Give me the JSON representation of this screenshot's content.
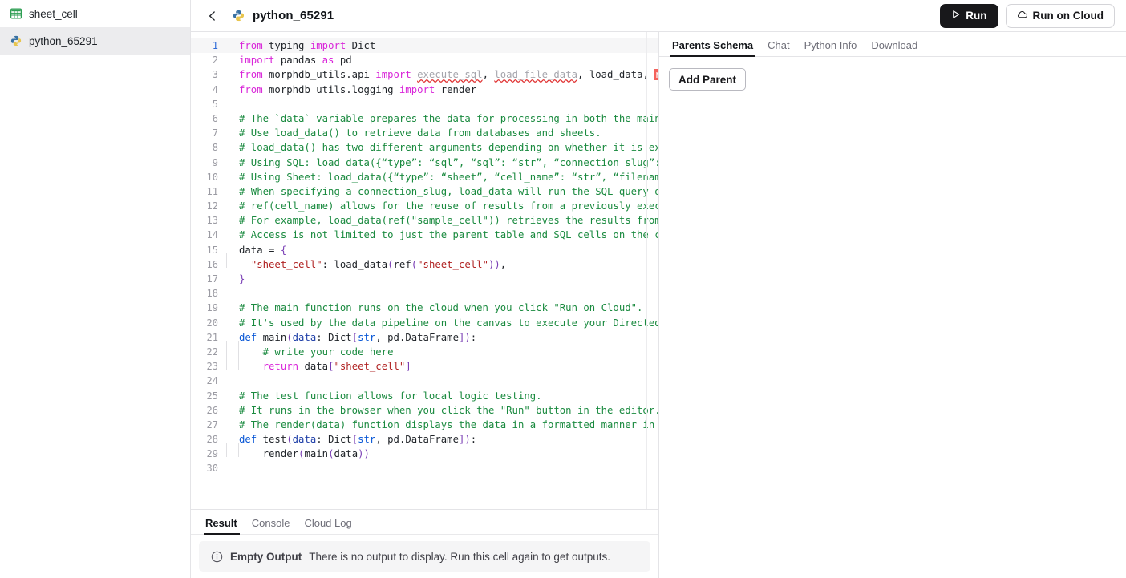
{
  "sidebar": {
    "items": [
      {
        "label": "sheet_cell",
        "icon": "sheet-grid-icon",
        "selected": false
      },
      {
        "label": "python_65291",
        "icon": "python-logo-icon",
        "selected": true
      }
    ]
  },
  "topbar": {
    "back_icon": "back-arrow-icon",
    "doc_icon": "python-logo-icon",
    "title": "python_65291",
    "run_label": "Run",
    "run_icon": "play-icon",
    "run_cloud_label": "Run on Cloud",
    "run_cloud_icon": "cloud-icon"
  },
  "editor": {
    "language": "python",
    "active_line": 1,
    "total_lines": 30,
    "lines": [
      {
        "n": 1,
        "tokens": [
          {
            "t": "from",
            "c": "kw"
          },
          {
            "t": " typing ",
            "c": "pl"
          },
          {
            "t": "import",
            "c": "kw"
          },
          {
            "t": " Dict",
            "c": "pl"
          }
        ]
      },
      {
        "n": 2,
        "tokens": [
          {
            "t": "import",
            "c": "kw"
          },
          {
            "t": " pandas ",
            "c": "pl"
          },
          {
            "t": "as",
            "c": "kw"
          },
          {
            "t": " pd",
            "c": "pl"
          }
        ]
      },
      {
        "n": 3,
        "tokens": [
          {
            "t": "from",
            "c": "kw"
          },
          {
            "t": " morphdb_utils.api ",
            "c": "pl"
          },
          {
            "t": "import",
            "c": "kw"
          },
          {
            "t": " ",
            "c": "pl"
          },
          {
            "t": "execute_sql",
            "c": "err"
          },
          {
            "t": ", ",
            "c": "pl"
          },
          {
            "t": "load_file_data",
            "c": "err"
          },
          {
            "t": ", load_data, ",
            "c": "pl"
          },
          {
            "t": "re",
            "c": "errhl"
          }
        ]
      },
      {
        "n": 4,
        "tokens": [
          {
            "t": "from",
            "c": "kw"
          },
          {
            "t": " morphdb_utils.logging ",
            "c": "pl"
          },
          {
            "t": "import",
            "c": "kw"
          },
          {
            "t": " render",
            "c": "pl"
          }
        ]
      },
      {
        "n": 5,
        "tokens": []
      },
      {
        "n": 6,
        "tokens": [
          {
            "t": "# The `data` variable prepares the data for processing in both the main a",
            "c": "cmt"
          }
        ]
      },
      {
        "n": 7,
        "tokens": [
          {
            "t": "# Use load_data() to retrieve data from databases and sheets.",
            "c": "cmt"
          }
        ]
      },
      {
        "n": 8,
        "tokens": [
          {
            "t": "# load_data() has two different arguments depending on whether it is exec",
            "c": "cmt"
          }
        ]
      },
      {
        "n": 9,
        "tokens": [
          {
            "t": "# Using SQL: load_data({“type”: “sql”, “sql”: “str”, “connection_slug”: “",
            "c": "cmt"
          }
        ]
      },
      {
        "n": 10,
        "tokens": [
          {
            "t": "# Using Sheet: load_data({“type”: “sheet”, “cell_name”: “str”, “filename",
            "c": "cmt"
          }
        ]
      },
      {
        "n": 11,
        "tokens": [
          {
            "t": "# When specifying a connection_slug, load_data will run the SQL query on ",
            "c": "cmt"
          }
        ]
      },
      {
        "n": 12,
        "tokens": [
          {
            "t": "# ref(cell_name) allows for the reuse of results from a previously execut",
            "c": "cmt"
          }
        ]
      },
      {
        "n": 13,
        "tokens": [
          {
            "t": "# For example, load_data(ref(\"sample_cell\")) retrieves the results from t",
            "c": "cmt"
          }
        ]
      },
      {
        "n": 14,
        "tokens": [
          {
            "t": "# Access is not limited to just the parent table and SQL cells on the can",
            "c": "cmt"
          }
        ]
      },
      {
        "n": 15,
        "tokens": [
          {
            "t": "data ",
            "c": "pl"
          },
          {
            "t": "=",
            "c": "pl"
          },
          {
            "t": " ",
            "c": "pl"
          },
          {
            "t": "{",
            "c": "brk"
          }
        ]
      },
      {
        "n": 16,
        "indent": 1,
        "tokens": [
          {
            "t": "  ",
            "c": "pl"
          },
          {
            "t": "\"sheet_cell\"",
            "c": "str"
          },
          {
            "t": ": ",
            "c": "pl"
          },
          {
            "t": "load_data",
            "c": "pl"
          },
          {
            "t": "(",
            "c": "brk"
          },
          {
            "t": "ref",
            "c": "pl"
          },
          {
            "t": "(",
            "c": "brk"
          },
          {
            "t": "\"sheet_cell\"",
            "c": "str"
          },
          {
            "t": ")",
            "c": "brk"
          },
          {
            "t": ")",
            "c": "brk"
          },
          {
            "t": ",",
            "c": "pl"
          }
        ]
      },
      {
        "n": 17,
        "tokens": [
          {
            "t": "}",
            "c": "brk"
          }
        ]
      },
      {
        "n": 18,
        "tokens": []
      },
      {
        "n": 19,
        "tokens": [
          {
            "t": "# The main function runs on the cloud when you click \"Run on Cloud\".",
            "c": "cmt"
          }
        ]
      },
      {
        "n": 20,
        "tokens": [
          {
            "t": "# It's used by the data pipeline on the canvas to execute your Directed A",
            "c": "cmt"
          }
        ]
      },
      {
        "n": 21,
        "tokens": [
          {
            "t": "def",
            "c": "kw2"
          },
          {
            "t": " ",
            "c": "pl"
          },
          {
            "t": "main",
            "c": "pl"
          },
          {
            "t": "(",
            "c": "brk"
          },
          {
            "t": "data",
            "c": "var"
          },
          {
            "t": ": Dict",
            "c": "pl"
          },
          {
            "t": "[",
            "c": "brk"
          },
          {
            "t": "str",
            "c": "kw2"
          },
          {
            "t": ", pd.DataFrame",
            "c": "pl"
          },
          {
            "t": "]",
            "c": "brk"
          },
          {
            "t": ")",
            "c": "brk"
          },
          {
            "t": ":",
            "c": "pl"
          }
        ]
      },
      {
        "n": 22,
        "indent": 2,
        "tokens": [
          {
            "t": "    # write your code here",
            "c": "cmt"
          }
        ]
      },
      {
        "n": 23,
        "indent": 2,
        "tokens": [
          {
            "t": "    ",
            "c": "pl"
          },
          {
            "t": "return",
            "c": "kw"
          },
          {
            "t": " data",
            "c": "pl"
          },
          {
            "t": "[",
            "c": "brk"
          },
          {
            "t": "\"sheet_cell\"",
            "c": "str"
          },
          {
            "t": "]",
            "c": "brk"
          }
        ]
      },
      {
        "n": 24,
        "tokens": []
      },
      {
        "n": 25,
        "tokens": [
          {
            "t": "# The test function allows for local logic testing.",
            "c": "cmt"
          }
        ]
      },
      {
        "n": 26,
        "tokens": [
          {
            "t": "# It runs in the browser when you click the \"Run\" button in the editor.",
            "c": "cmt"
          }
        ]
      },
      {
        "n": 27,
        "tokens": [
          {
            "t": "# The render(data) function displays the data in a formatted manner in th",
            "c": "cmt"
          }
        ]
      },
      {
        "n": 28,
        "tokens": [
          {
            "t": "def",
            "c": "kw2"
          },
          {
            "t": " ",
            "c": "pl"
          },
          {
            "t": "test",
            "c": "pl"
          },
          {
            "t": "(",
            "c": "brk"
          },
          {
            "t": "data",
            "c": "var"
          },
          {
            "t": ": Dict",
            "c": "pl"
          },
          {
            "t": "[",
            "c": "brk"
          },
          {
            "t": "str",
            "c": "kw2"
          },
          {
            "t": ", pd.DataFrame",
            "c": "pl"
          },
          {
            "t": "]",
            "c": "brk"
          },
          {
            "t": ")",
            "c": "brk"
          },
          {
            "t": ":",
            "c": "pl"
          }
        ]
      },
      {
        "n": 29,
        "indent": 2,
        "tokens": [
          {
            "t": "    ",
            "c": "pl"
          },
          {
            "t": "render",
            "c": "pl"
          },
          {
            "t": "(",
            "c": "brk"
          },
          {
            "t": "main",
            "c": "pl"
          },
          {
            "t": "(",
            "c": "brk"
          },
          {
            "t": "data",
            "c": "pl"
          },
          {
            "t": ")",
            "c": "brk"
          },
          {
            "t": ")",
            "c": "brk"
          }
        ]
      },
      {
        "n": 30,
        "tokens": []
      }
    ]
  },
  "result_panel": {
    "tabs": [
      {
        "label": "Result",
        "active": true
      },
      {
        "label": "Console",
        "active": false
      },
      {
        "label": "Cloud Log",
        "active": false
      }
    ],
    "empty": {
      "icon": "info-circle-icon",
      "title": "Empty Output",
      "message": "There is no output to display. Run this cell again to get outputs."
    }
  },
  "right_panel": {
    "tabs": [
      {
        "label": "Parents Schema",
        "active": true
      },
      {
        "label": "Chat",
        "active": false
      },
      {
        "label": "Python Info",
        "active": false
      },
      {
        "label": "Download",
        "active": false
      }
    ],
    "add_parent_label": "Add Parent"
  },
  "colors": {
    "accent_dark": "#18181b",
    "keyword": "#d926d9",
    "keyword_blue": "#0a58d6",
    "comment": "#1a8a3f",
    "string": "#b02222",
    "error": "#e03131",
    "error_highlight": "#f4625c",
    "selected_row": "#ececee",
    "border": "#e4e4e7"
  }
}
